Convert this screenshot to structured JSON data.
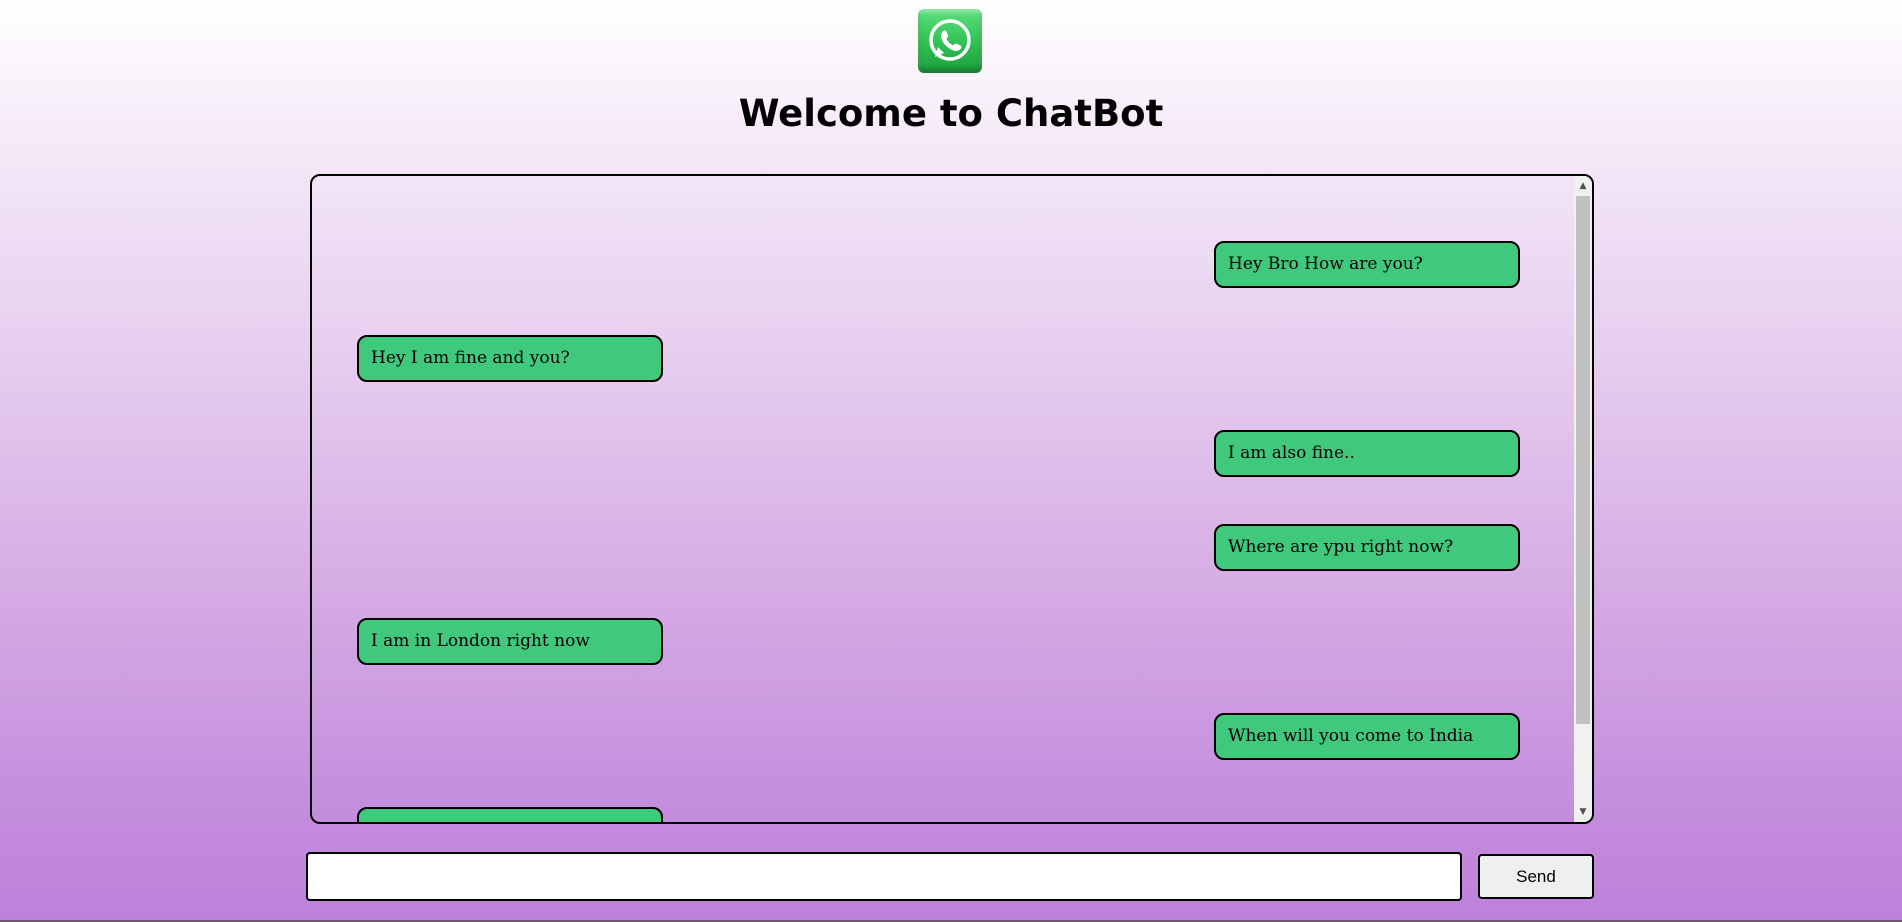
{
  "header": {
    "logo_icon": "whatsapp-icon",
    "title": "Welcome to ChatBot"
  },
  "chat": {
    "messages": [
      {
        "side": "right",
        "text": "Hey Bro How are you?"
      },
      {
        "side": "left",
        "text": "Hey I am fine and you?"
      },
      {
        "side": "right",
        "text": "I am also fine.."
      },
      {
        "side": "right",
        "text": "Where are ypu right now?"
      },
      {
        "side": "left",
        "text": "I am in London right now"
      },
      {
        "side": "right",
        "text": "When will you come to India"
      },
      {
        "side": "left",
        "text": ""
      }
    ],
    "bubble_color": "#40c87c"
  },
  "composer": {
    "input_value": "",
    "input_placeholder": "",
    "send_label": "Send"
  }
}
